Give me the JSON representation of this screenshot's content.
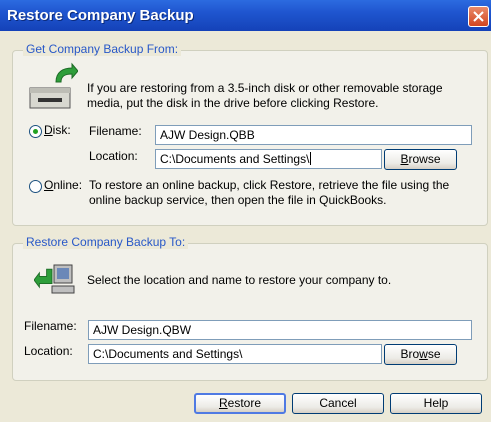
{
  "window": {
    "title": "Restore Company Backup"
  },
  "from_group": {
    "legend": "Get Company Backup From:",
    "info": "If you are restoring from a 3.5-inch disk or other removable storage media, put the disk in the drive before clicking Restore.",
    "disk": {
      "label_pre": "",
      "label_u": "D",
      "label_post": "isk:",
      "selected": true,
      "filename_label": "Filename:",
      "filename": "AJW Design.QBB",
      "location_label": "Location:",
      "location": "C:\\Documents and Settings\\",
      "browse_u": "B",
      "browse_post": "rowse"
    },
    "online": {
      "label_u": "O",
      "label_post": "nline:",
      "selected": false,
      "info": "To restore an online backup, click Restore, retrieve the file using the online backup service, then open the file in QuickBooks."
    }
  },
  "to_group": {
    "legend": "Restore Company Backup To:",
    "info": "Select the location and name to restore your company to.",
    "filename_label": "Filename:",
    "filename": "AJW Design.QBW",
    "location_label": "Location:",
    "location": "C:\\Documents and Settings\\",
    "browse_pre": "Bro",
    "browse_u": "w",
    "browse_post": "se"
  },
  "buttons": {
    "restore_u": "R",
    "restore_post": "estore",
    "cancel": "Cancel",
    "help": "Help"
  },
  "colors": {
    "title_bar": "#1f55cf",
    "legend_text": "#2858c8",
    "close_button": "#d2451f"
  }
}
